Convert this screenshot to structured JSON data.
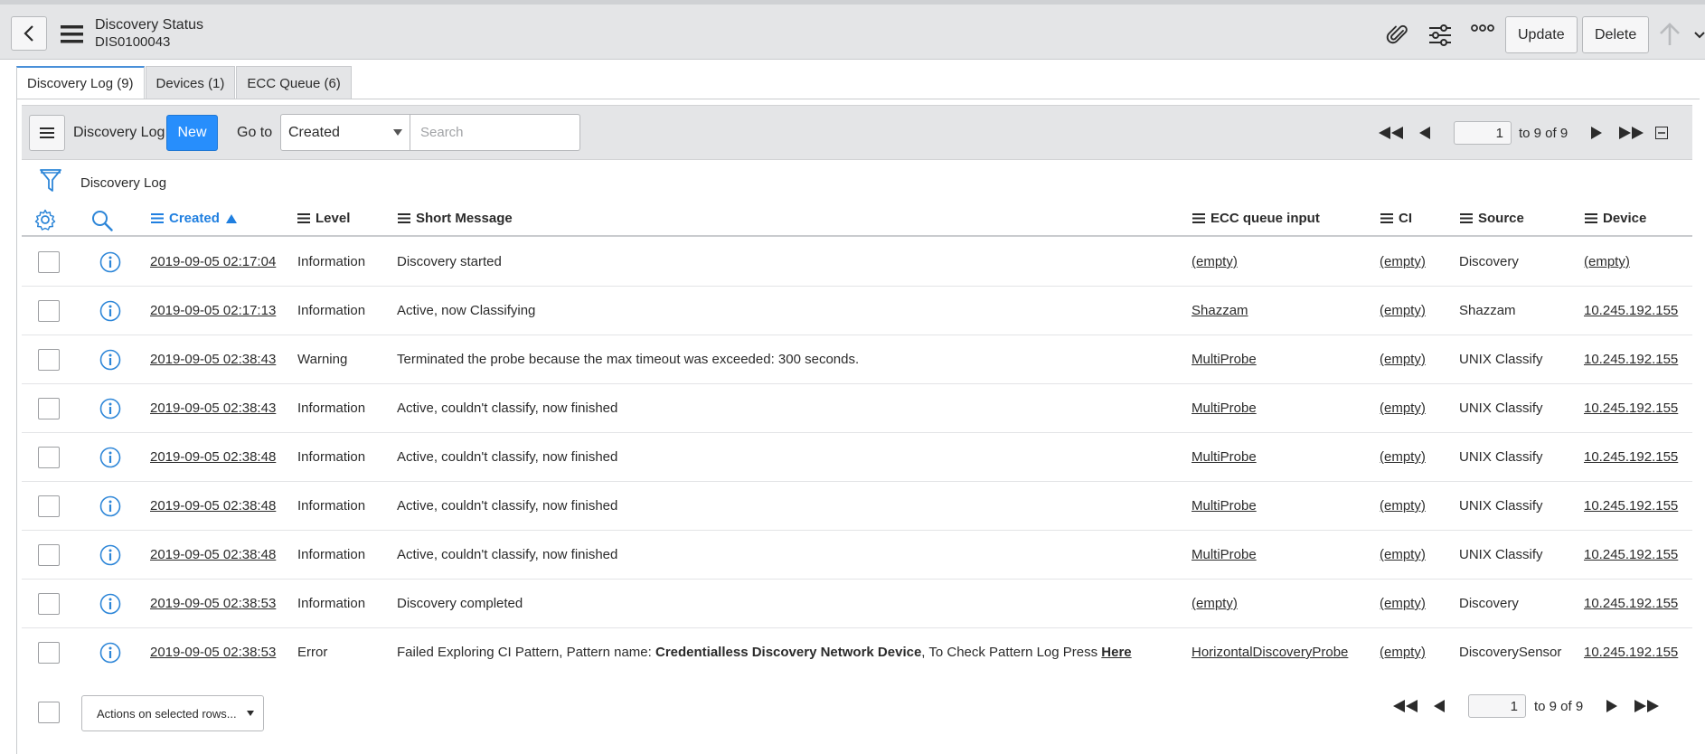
{
  "header": {
    "title": "Discovery Status",
    "subtitle": "DIS0100043",
    "update_label": "Update",
    "delete_label": "Delete"
  },
  "tabs": [
    {
      "label": "Discovery Log (9)",
      "active": true
    },
    {
      "label": "Devices (1)",
      "active": false
    },
    {
      "label": "ECC Queue (6)",
      "active": false
    }
  ],
  "list": {
    "title": "Discovery Log",
    "new_label": "New",
    "goto_label": "Go to",
    "goto_selected": "Created",
    "search_placeholder": "Search",
    "page_value": "1",
    "range_text": "to 9 of 9",
    "breadcrumb": "Discovery Log",
    "actions_label": "Actions on selected rows...",
    "accent_color": "#278efc",
    "sort_color": "#1f7fe0"
  },
  "columns": {
    "created": "Created",
    "level": "Level",
    "short_message": "Short Message",
    "ecc_queue_input": "ECC queue input",
    "ci": "CI",
    "source": "Source",
    "device": "Device"
  },
  "rows": [
    {
      "created": "2019-09-05 02:17:04",
      "level": "Information",
      "message": "Discovery started",
      "ecc": "(empty)",
      "ci": "(empty)",
      "source": "Discovery",
      "device": "(empty)"
    },
    {
      "created": "2019-09-05 02:17:13",
      "level": "Information",
      "message": "Active, now Classifying",
      "ecc": "Shazzam",
      "ci": "(empty)",
      "source": "Shazzam",
      "device": "10.245.192.155"
    },
    {
      "created": "2019-09-05 02:38:43",
      "level": "Warning",
      "message": "Terminated the probe because the max timeout was exceeded: 300 seconds.",
      "ecc": "MultiProbe",
      "ci": "(empty)",
      "source": "UNIX Classify",
      "device": "10.245.192.155"
    },
    {
      "created": "2019-09-05 02:38:43",
      "level": "Information",
      "message": "Active, couldn't classify, now finished",
      "ecc": "MultiProbe",
      "ci": "(empty)",
      "source": "UNIX Classify",
      "device": "10.245.192.155"
    },
    {
      "created": "2019-09-05 02:38:48",
      "level": "Information",
      "message": "Active, couldn't classify, now finished",
      "ecc": "MultiProbe",
      "ci": "(empty)",
      "source": "UNIX Classify",
      "device": "10.245.192.155"
    },
    {
      "created": "2019-09-05 02:38:48",
      "level": "Information",
      "message": "Active, couldn't classify, now finished",
      "ecc": "MultiProbe",
      "ci": "(empty)",
      "source": "UNIX Classify",
      "device": "10.245.192.155"
    },
    {
      "created": "2019-09-05 02:38:48",
      "level": "Information",
      "message": "Active, couldn't classify, now finished",
      "ecc": "MultiProbe",
      "ci": "(empty)",
      "source": "UNIX Classify",
      "device": "10.245.192.155"
    },
    {
      "created": "2019-09-05 02:38:53",
      "level": "Information",
      "message": "Discovery completed",
      "ecc": "(empty)",
      "ci": "(empty)",
      "source": "Discovery",
      "device": "10.245.192.155"
    },
    {
      "created": "2019-09-05 02:38:53",
      "level": "Error",
      "message_prefix": "Failed Exploring CI Pattern, Pattern name: ",
      "message_bold": "Credentialless Discovery Network Device",
      "message_mid": ", To Check Pattern Log Press ",
      "message_link": "Here",
      "ecc": "HorizontalDiscoveryProbe",
      "ci": "(empty)",
      "source": "DiscoverySensor",
      "device": "10.245.192.155"
    }
  ]
}
